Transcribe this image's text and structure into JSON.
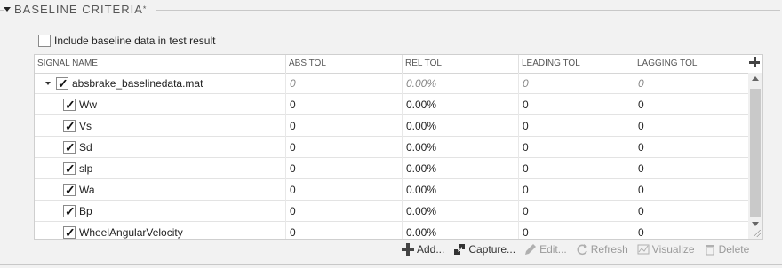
{
  "section": {
    "title": "BASELINE CRITERIA",
    "marker": "*"
  },
  "include_checkbox": {
    "label": "Include baseline data in test result",
    "checked": false
  },
  "table": {
    "columns": [
      "SIGNAL NAME",
      "ABS TOL",
      "REL TOL",
      "LEADING TOL",
      "LAGGING TOL"
    ],
    "parent": {
      "name": "absbrake_baselinedata.mat",
      "abs_tol": "0",
      "rel_tol": "0.00%",
      "leading_tol": "0",
      "lagging_tol": "0",
      "checked": true
    },
    "signals": [
      {
        "name": "Ww",
        "abs_tol": "0",
        "rel_tol": "0.00%",
        "leading_tol": "0",
        "lagging_tol": "0"
      },
      {
        "name": "Vs",
        "abs_tol": "0",
        "rel_tol": "0.00%",
        "leading_tol": "0",
        "lagging_tol": "0"
      },
      {
        "name": "Sd",
        "abs_tol": "0",
        "rel_tol": "0.00%",
        "leading_tol": "0",
        "lagging_tol": "0"
      },
      {
        "name": "slp",
        "abs_tol": "0",
        "rel_tol": "0.00%",
        "leading_tol": "0",
        "lagging_tol": "0"
      },
      {
        "name": "Wa",
        "abs_tol": "0",
        "rel_tol": "0.00%",
        "leading_tol": "0",
        "lagging_tol": "0"
      },
      {
        "name": "Bp",
        "abs_tol": "0",
        "rel_tol": "0.00%",
        "leading_tol": "0",
        "lagging_tol": "0"
      },
      {
        "name": "WheelAngularVelocity",
        "abs_tol": "0",
        "rel_tol": "0.00%",
        "leading_tol": "0",
        "lagging_tol": "0"
      }
    ]
  },
  "toolbar": {
    "add": "Add...",
    "capture": "Capture...",
    "edit": "Edit...",
    "refresh": "Refresh",
    "visualize": "Visualize",
    "delete": "Delete"
  },
  "check_glyph": "✓",
  "colors": {
    "background": "#f2f2f2",
    "table_bg": "#ffffff",
    "scroll_thumb": "#c9c9c9",
    "disabled_text": "#9a9a9a"
  }
}
